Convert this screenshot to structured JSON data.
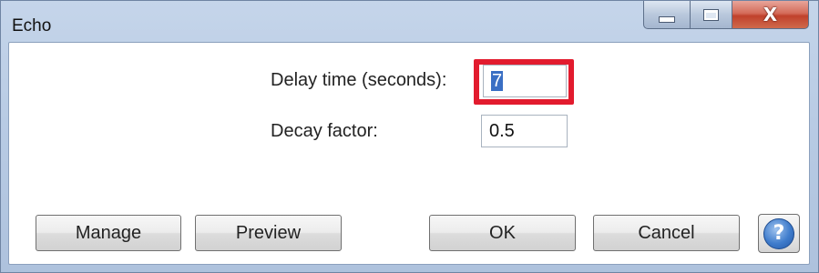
{
  "window": {
    "title": "Echo"
  },
  "titlebar": {
    "minimize_icon": "minimize-icon",
    "maximize_icon": "maximize-icon",
    "close_icon": "close-icon",
    "close_glyph": "X"
  },
  "form": {
    "delay_label": "Delay time (seconds):",
    "delay_value": "7",
    "decay_label": "Decay factor:",
    "decay_value": "0.5"
  },
  "buttons": {
    "manage": "Manage",
    "preview": "Preview",
    "ok": "OK",
    "cancel": "Cancel",
    "help_glyph": "?"
  },
  "annotation": {
    "highlight_color": "#e21b2e"
  },
  "colors": {
    "selection": "#3a6fc4",
    "help_blue": "#3f7ccc"
  }
}
